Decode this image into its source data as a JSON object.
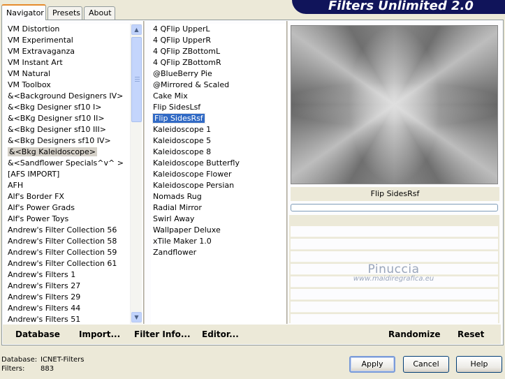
{
  "tabs": [
    "Navigator",
    "Presets",
    "About"
  ],
  "title": "Filters Unlimited 2.0",
  "categories": [
    "VM Distortion",
    "VM Experimental",
    "VM Extravaganza",
    "VM Instant Art",
    "VM Natural",
    "VM Toolbox",
    "&<Background Designers IV>",
    "&<Bkg Designer sf10 I>",
    "&<BKg Designer sf10 II>",
    "&<Bkg Designer sf10 III>",
    "&<Bkg Designers sf10 IV>",
    "&<Bkg Kaleidoscope>",
    "&<Sandflower Specials^v^ >",
    "[AFS IMPORT]",
    "AFH",
    "Alf's Border FX",
    "Alf's Power Grads",
    "Alf's Power Toys",
    "Andrew's Filter Collection 56",
    "Andrew's Filter Collection 58",
    "Andrew's Filter Collection 59",
    "Andrew's Filter Collection 61",
    "Andrew's Filters 1",
    "Andrew's Filters 27",
    "Andrew's Filters 29",
    "Andrew's Filters 44",
    "Andrew's Filters 51"
  ],
  "selected_category_index": 11,
  "filters": [
    "4 QFlip UpperL",
    "4 QFlip UpperR",
    "4 QFlip ZBottomL",
    "4 QFlip ZBottomR",
    "@BlueBerry Pie",
    "@Mirrored & Scaled",
    "Cake Mix",
    "Flip SidesLsf",
    "Flip SidesRsf",
    "Kaleidoscope 1",
    "Kaleidoscope 5",
    "Kaleidoscope 8",
    "Kaleidoscope Butterfly",
    "Kaleidoscope Flower",
    "Kaleidoscope Persian",
    "Nomads Rug",
    "Radial Mirror",
    "Swirl Away",
    "Wallpaper Deluxe",
    "xTile Maker 1.0",
    "Zandflower"
  ],
  "selected_filter_index": 8,
  "preview_label": "Flip SidesRsf",
  "progress": 0,
  "watermark": {
    "line1": "Pinuccia",
    "line2": "www.maidiregrafica.eu"
  },
  "panel_buttons": {
    "database": "Database",
    "import": "Import...",
    "filter_info": "Filter Info...",
    "editor": "Editor...",
    "randomize": "Randomize",
    "reset": "Reset"
  },
  "status": {
    "database_label": "Database:",
    "database_value": "ICNET-Filters",
    "filters_label": "Filters:",
    "filters_value": "883"
  },
  "dialog_buttons": {
    "apply": "Apply",
    "cancel": "Cancel",
    "help": "Help"
  },
  "colors": {
    "banner": "#10145a",
    "selection": "#316ac5",
    "category_highlight": "#d4d0c8"
  },
  "icons": {
    "scroll_up": "chevron-up-icon",
    "scroll_down": "chevron-down-icon"
  }
}
